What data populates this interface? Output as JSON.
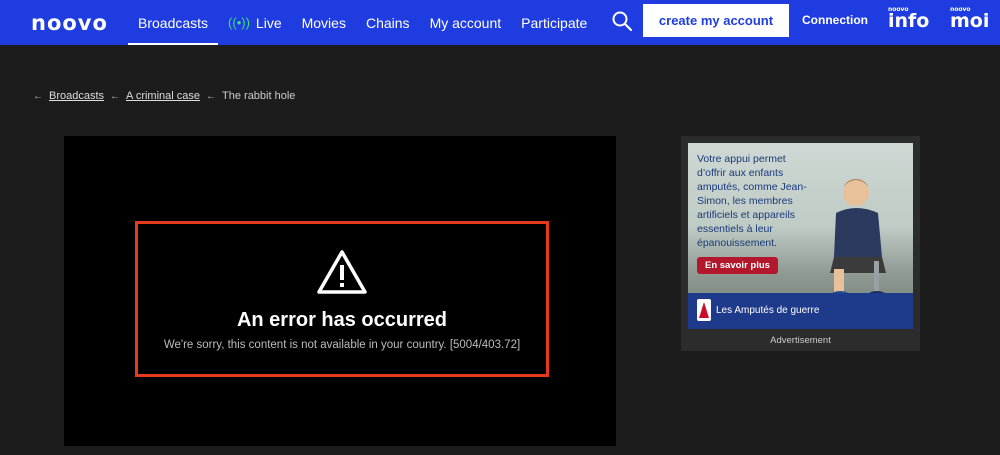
{
  "header": {
    "logo": "noovo",
    "nav": [
      {
        "label": "Broadcasts",
        "active": true
      },
      {
        "label": "Live",
        "live": true
      },
      {
        "label": "Movies"
      },
      {
        "label": "Chains"
      },
      {
        "label": "My account"
      },
      {
        "label": "Participate"
      }
    ],
    "create_account": "create my account",
    "connection": "Connection",
    "brand_info_small": "noovo",
    "brand_info_big": "info",
    "brand_moi_small": "noovo",
    "brand_moi_big": "moi",
    "brand_color": "#1f3ce0"
  },
  "breadcrumb": {
    "items": [
      "Broadcasts",
      "A criminal case"
    ],
    "current": "The rabbit hole"
  },
  "player": {
    "error_title": "An error has occurred",
    "error_message": "We're sorry, this content is not available in your country. [5004/403.72]",
    "border_color": "#e53a1e"
  },
  "ad": {
    "text": "Votre appui permet d’offrir aux enfants amputés, comme Jean-Simon, les membres artificiels et appareils essentiels à leur épanouissement.",
    "cta": "En savoir plus",
    "org": "Les Amputés de guerre",
    "label": "Advertisement"
  }
}
